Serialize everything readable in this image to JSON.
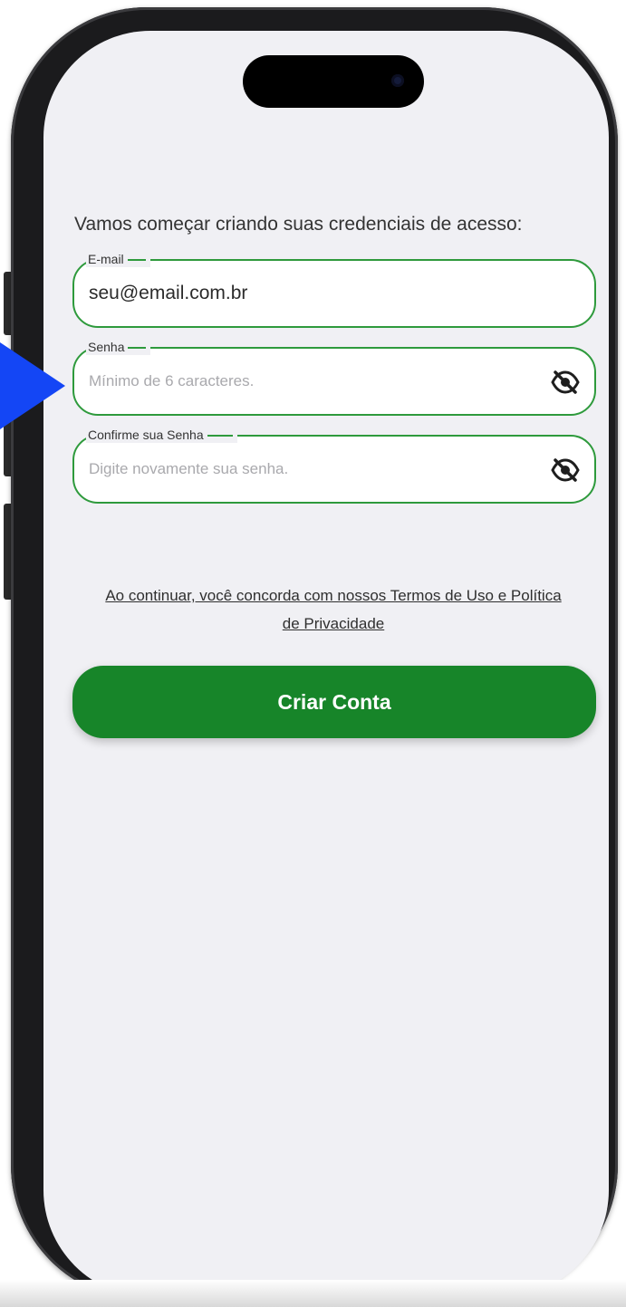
{
  "screen": {
    "intro_text": "Vamos começar criando suas credenciais de acesso:"
  },
  "form": {
    "email": {
      "label": "E-mail",
      "value": "seu@email.com.br",
      "placeholder": ""
    },
    "password": {
      "label": "Senha",
      "value": "",
      "placeholder": "Mínimo de 6 caracteres.",
      "toggle_icon": "eye-off-icon"
    },
    "confirm_password": {
      "label": "Confirme sua Senha",
      "value": "",
      "placeholder": "Digite novamente sua senha.",
      "toggle_icon": "eye-off-icon"
    }
  },
  "terms_text": "Ao continuar, você concorda com nossos Termos de Uso e Política de Privacidade",
  "submit_label": "Criar Conta",
  "colors": {
    "accent_green": "#178529",
    "field_border": "#2e9a3c",
    "background": "#f0f0f4",
    "pointer_blue": "#1446f5"
  }
}
